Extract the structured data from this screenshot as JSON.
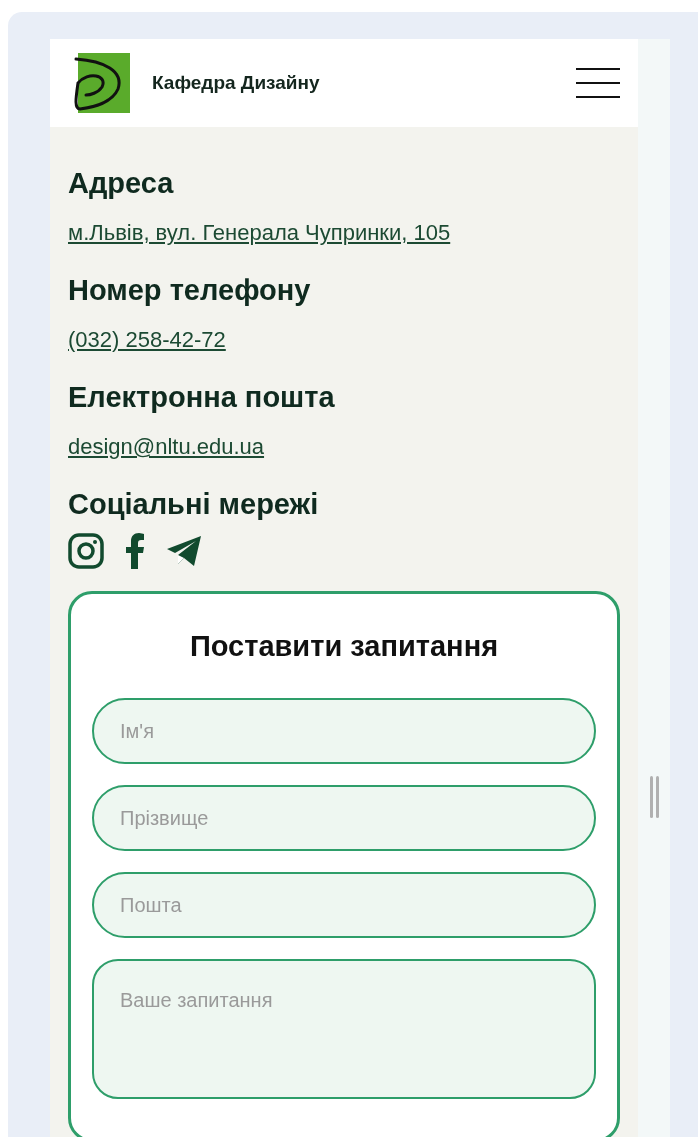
{
  "header": {
    "title": "Кафедра Дизайну"
  },
  "contacts": [
    {
      "heading": "Адреса",
      "link": "м.Львів, вул. Генерала Чупринки, 105"
    },
    {
      "heading": "Номер телефону",
      "link": "(032) 258-42-72"
    },
    {
      "heading": "Електронна пошта",
      "link": "design@nltu.edu.ua"
    }
  ],
  "social": {
    "heading": "Соціальні мережі",
    "icons": [
      {
        "kind": "instagram"
      },
      {
        "kind": "facebook"
      },
      {
        "kind": "telegram"
      }
    ]
  },
  "form": {
    "title": "Поставити запитання",
    "fields": [
      {
        "placeholder": "Ім'я",
        "kind": "input"
      },
      {
        "placeholder": "Прізвище",
        "kind": "input"
      },
      {
        "placeholder": "Пошта",
        "kind": "input"
      },
      {
        "placeholder": "Ваше запитання",
        "kind": "textarea"
      }
    ]
  }
}
